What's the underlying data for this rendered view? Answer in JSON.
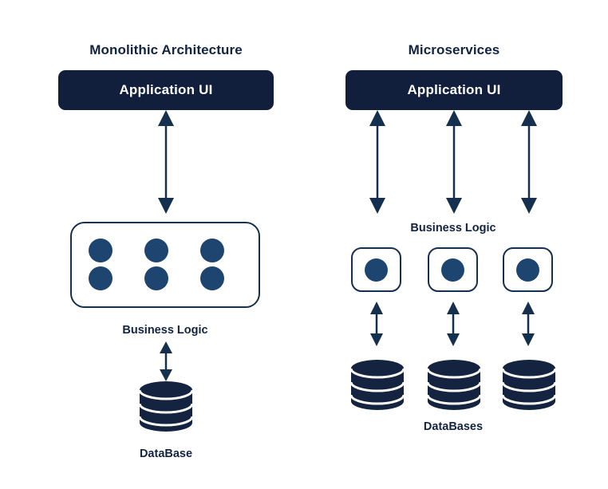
{
  "diagram": {
    "title": "Monolithic Architecture vs Microservices",
    "background": "#ffffff",
    "colors": {
      "box_fill": "#111f3c",
      "box_text": "#ffffff",
      "outline": "#15304f",
      "dot": "#1d456f",
      "label_text": "#132440",
      "database": "#14233f",
      "arrow": "#15304f"
    }
  },
  "monolith": {
    "title": "Monolithic Architecture",
    "app_ui_label": "Application UI",
    "business_logic_label": "Business Logic",
    "database_label": "DataBase",
    "module_count": 6,
    "database_count": 1,
    "arrow_ui_to_logic": "bidirectional",
    "arrow_logic_to_db": "bidirectional"
  },
  "microservices": {
    "title": "Microservices",
    "app_ui_label": "Application UI",
    "business_logic_label": "Business Logic",
    "database_label": "DataBases",
    "service_count": 3,
    "database_count": 3,
    "arrows_ui_to_services": "bidirectional",
    "arrows_services_to_db": "bidirectional"
  }
}
